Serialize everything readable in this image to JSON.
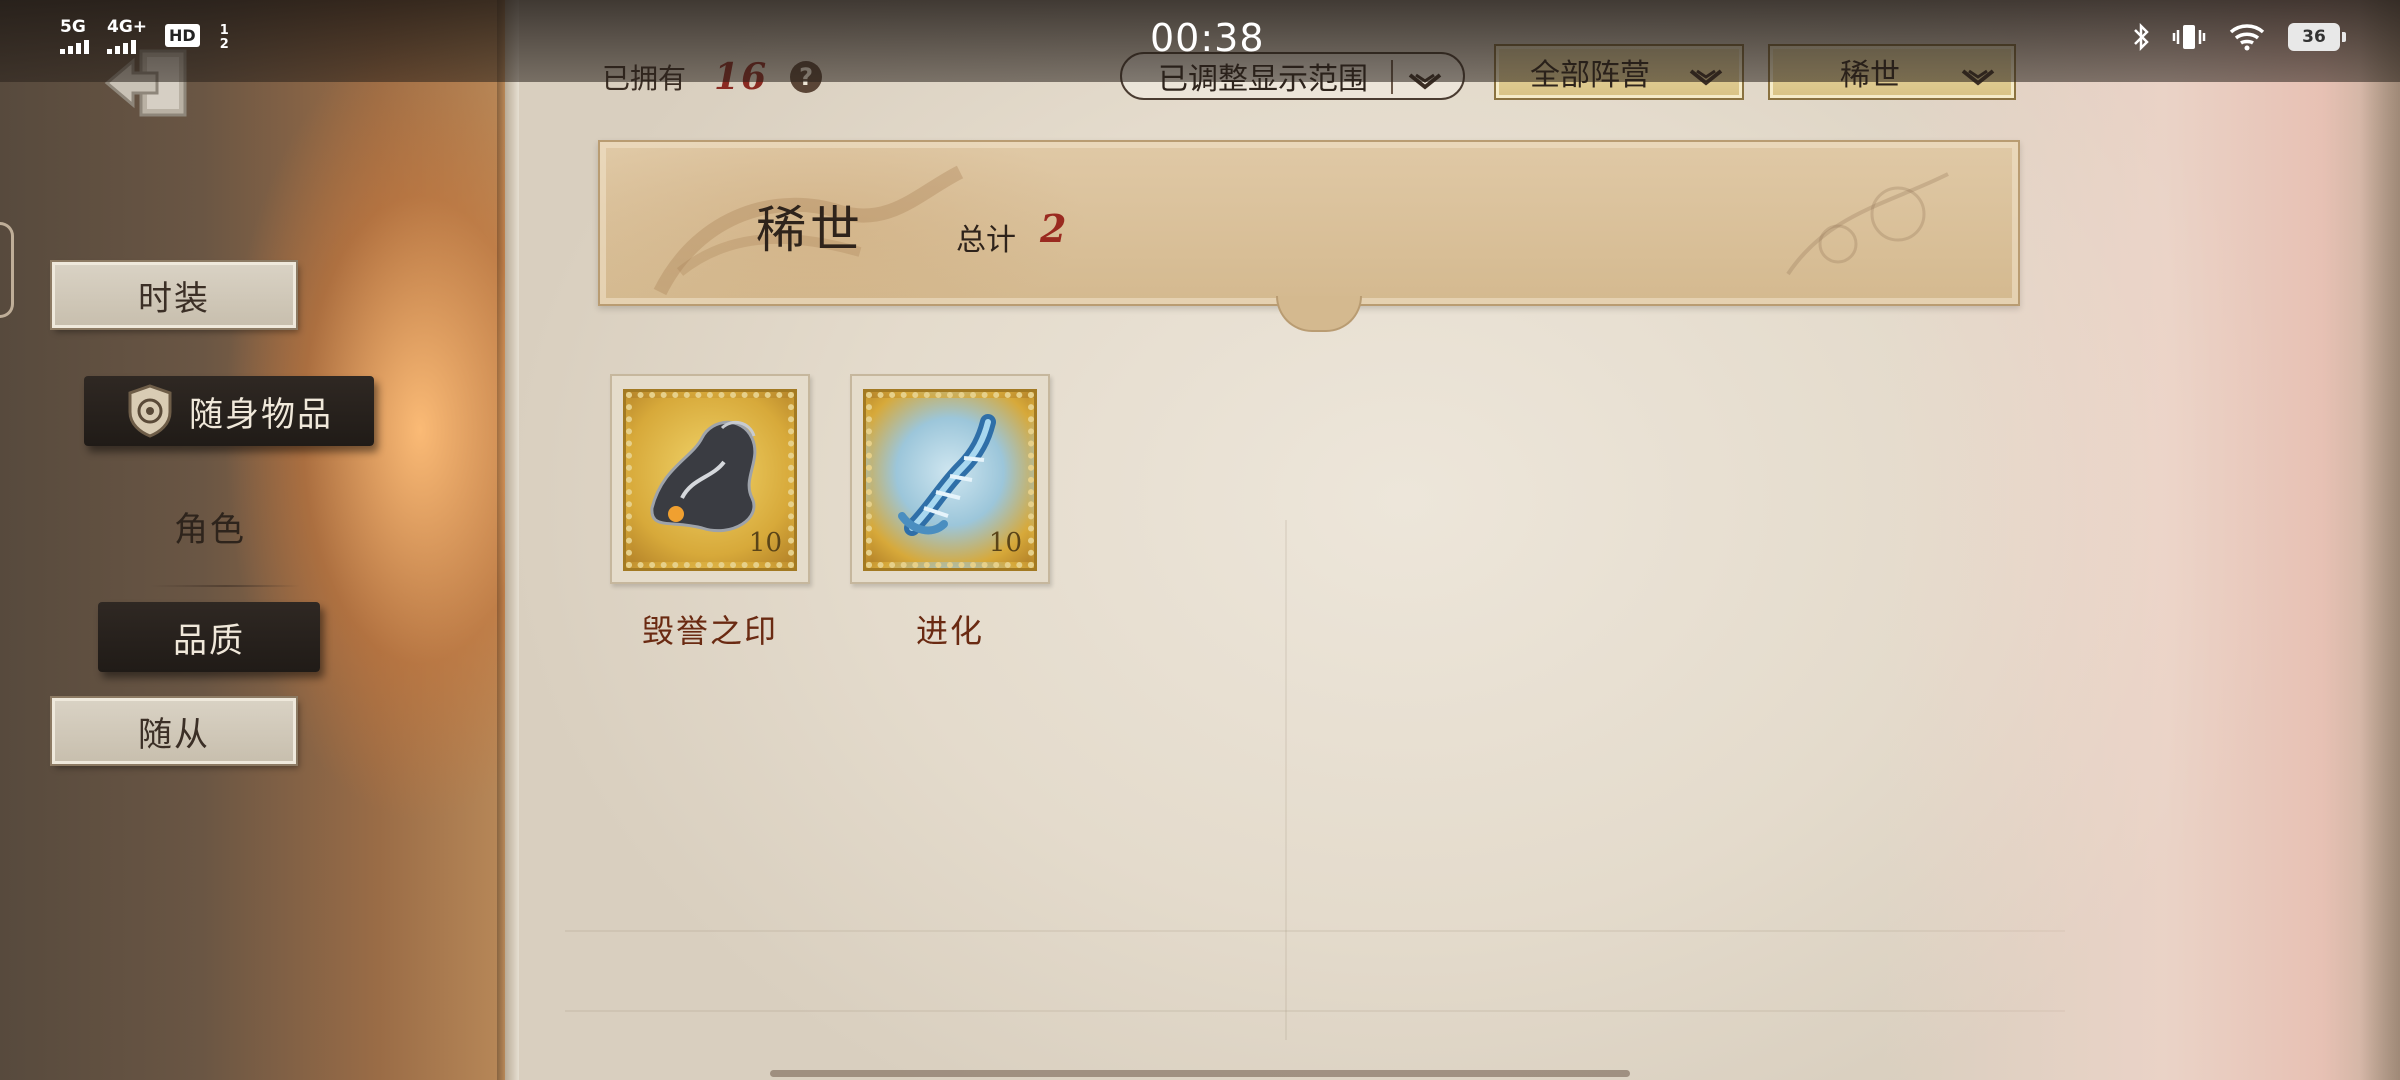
{
  "status_bar": {
    "signal_1": "5G",
    "signal_2": "4G+",
    "hd_badge": "HD",
    "hd_sub_top": "1",
    "hd_sub_bottom": "2",
    "time": "00:38",
    "battery": "36"
  },
  "sidebar": {
    "back_icon": "back-arrow-icon",
    "items": [
      {
        "label": "时装",
        "style": "paper"
      },
      {
        "label": "随身物品",
        "style": "dark-selected",
        "icon": "shield-badge-icon"
      },
      {
        "label": "角色",
        "style": "plain"
      },
      {
        "label": "品质",
        "style": "dark"
      },
      {
        "label": "随从",
        "style": "paper"
      }
    ]
  },
  "header": {
    "owned_label": "已拥有",
    "owned_count": "16",
    "help_glyph": "?",
    "range_dropdown": "已调整显示范围",
    "faction_dropdown": "全部阵营",
    "rarity_dropdown": "稀世"
  },
  "banner": {
    "title": "稀世",
    "total_label": "总计",
    "total_count": "2"
  },
  "items": [
    {
      "label": "毁誉之印",
      "stamp_value": "10",
      "icon": "dark-metal-emblem-icon"
    },
    {
      "label": "进化",
      "stamp_value": "10",
      "icon": "crystal-dna-icon"
    }
  ],
  "colors": {
    "accent_red": "#8a2a22",
    "item_label": "#6a2a12",
    "gold_dropdown": "#ecdcaa"
  }
}
